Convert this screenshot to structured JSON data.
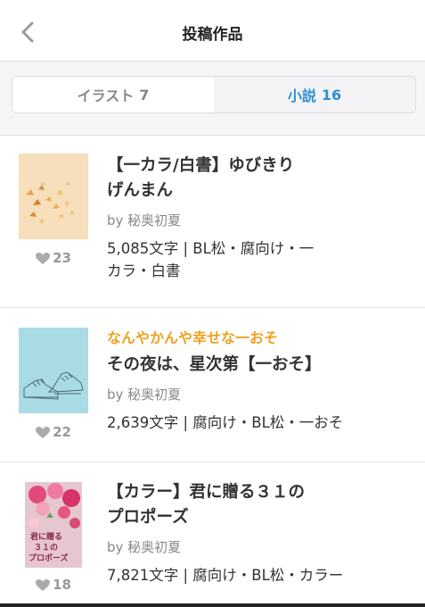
{
  "header": {
    "title": "投稿作品"
  },
  "tabs": [
    {
      "label": "イラスト",
      "count": "7"
    },
    {
      "label": "小説",
      "count": "16"
    }
  ],
  "works": [
    {
      "series": "",
      "title_line1": "【一カラ/白書】ゆびきり",
      "title_line2": "げんまん",
      "author": "by 秘奥初夏",
      "meta_line1": "5,085文字 | BL松・腐向け・一",
      "meta_line2": "カラ・白書",
      "likes": "23"
    },
    {
      "series": "なんやかんや幸せな一おそ",
      "title_line1": "その夜は、星次第【一おそ】",
      "title_line2": "",
      "author": "by 秘奥初夏",
      "meta_line1": "2,639文字 | 腐向け・BL松・一おそ",
      "meta_line2": "",
      "likes": "22"
    },
    {
      "series": "",
      "title_line1": "【カラー】君に贈る３１の",
      "title_line2": "プロポーズ",
      "author": "by 秘奥初夏",
      "meta_line1": "7,821文字 | 腐向け・BL松・カラー",
      "meta_line2": "",
      "likes": "18",
      "cover_text": [
        "君に贈る",
        "３１の",
        "プロポーズ"
      ]
    }
  ],
  "colors": {
    "accent": "#2b8fd6",
    "series": "#f0a020"
  }
}
